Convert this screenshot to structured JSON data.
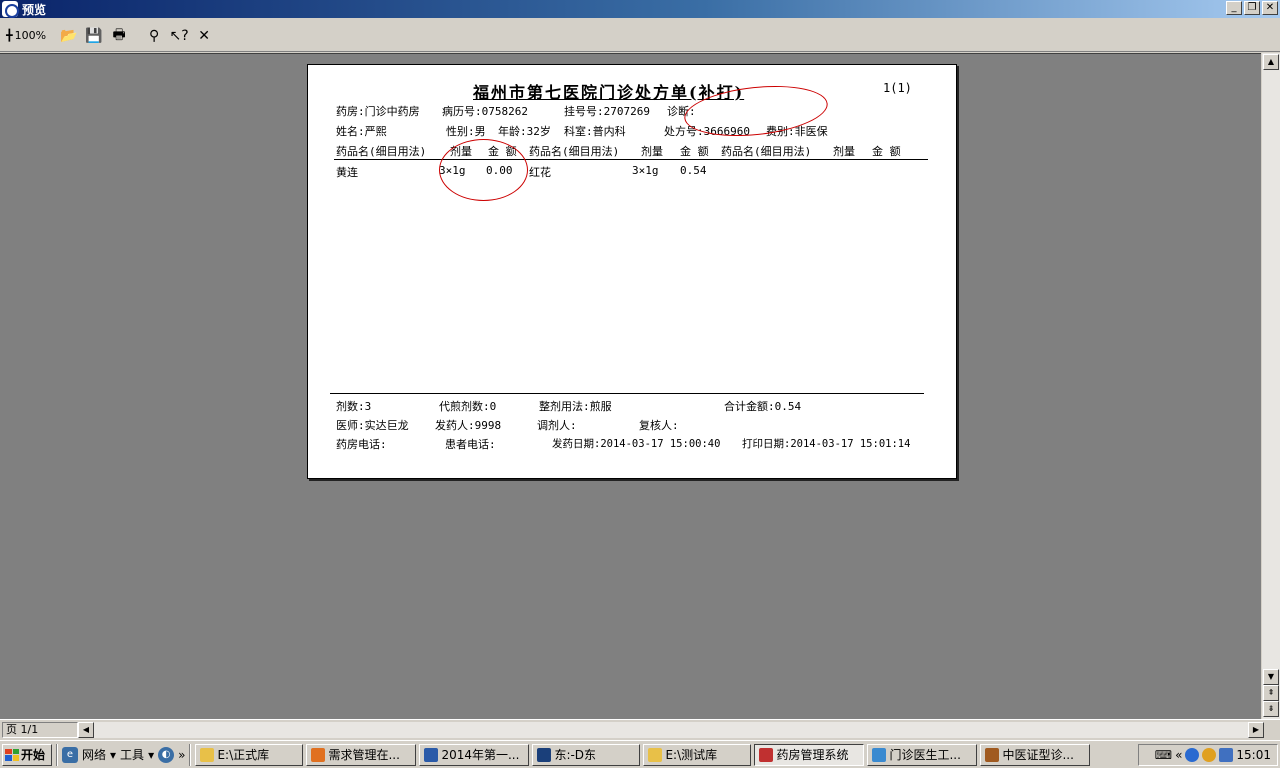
{
  "window": {
    "title": "预览"
  },
  "toolbar": {
    "zoom": "100%"
  },
  "report": {
    "title": "福州市第七医院门诊处方单(补打)",
    "page_no": "1(1)",
    "line1": {
      "pharmacy": "药房:门诊中药房",
      "record_no": "病历号:0758262",
      "reg_no": "挂号号:2707269",
      "diagnosis": "诊断:"
    },
    "line2": {
      "name": "姓名:严熙",
      "sex": "性别:男",
      "age": "年龄:32岁",
      "dept": "科室:普内科",
      "rx_no": "处方号:3666960",
      "fee_type": "费别:非医保"
    },
    "headers": [
      {
        "name": "药品名(细目用法)",
        "dose": "剂量",
        "amount": "金 额"
      },
      {
        "name": "药品名(细目用法)",
        "dose": "剂量",
        "amount": "金 额"
      },
      {
        "name": "药品名(细目用法)",
        "dose": "剂量",
        "amount": "金 额"
      }
    ],
    "items": [
      {
        "name": "黄连",
        "dose": "3×1g",
        "amount": "0.00"
      },
      {
        "name": "红花",
        "dose": "3×1g",
        "amount": "0.54"
      }
    ],
    "footer": {
      "doses": "剂数:3",
      "decoct": "代煎剂数:0",
      "usage": "整剂用法:煎服",
      "total": "合计金额:0.54",
      "doctor": "医师:实达巨龙",
      "dispenser": "发药人:9998",
      "preparer": "调剂人:",
      "checker": "复核人:",
      "pharmacy_phone": "药房电话:",
      "patient_phone": "患者电话:",
      "dispense_date": "发药日期:2014-03-17 15:00:40",
      "print_date": "打印日期:2014-03-17 15:01:14"
    }
  },
  "status": {
    "page": "页 1/1"
  },
  "taskbar": {
    "start": "开始",
    "quick": [
      "网络",
      "工具"
    ],
    "tasks": [
      {
        "label": "E:\\正式库",
        "active": false,
        "color": "#e8c048"
      },
      {
        "label": "需求管理在...",
        "active": false,
        "color": "#e07020"
      },
      {
        "label": "2014年第一...",
        "active": false,
        "color": "#2a5aa8"
      },
      {
        "label": "东:-D东",
        "active": false,
        "color": "#1a3f7a"
      },
      {
        "label": "E:\\测试库",
        "active": false,
        "color": "#e8c048"
      },
      {
        "label": "药房管理系统",
        "active": true,
        "color": "#c03030"
      },
      {
        "label": "门诊医生工...",
        "active": false,
        "color": "#3a8ad0"
      },
      {
        "label": "中医证型诊...",
        "active": false,
        "color": "#a05a20"
      }
    ],
    "clock": "15:01"
  }
}
